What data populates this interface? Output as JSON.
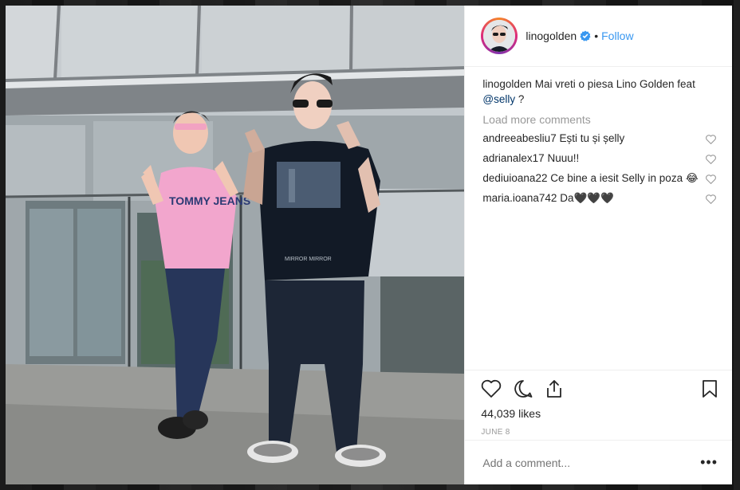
{
  "post": {
    "username": "linogolden",
    "follow_label": "Follow",
    "separator": "•",
    "caption_user": "linogolden",
    "caption_text": "Mai vreti o piesa Lino Golden feat",
    "caption_mention": "@selly",
    "caption_end": "?",
    "load_more_label": "Load more comments",
    "likes": "44,039 likes",
    "date": "JUNE 8",
    "add_comment_placeholder": "Add a comment...",
    "more_label": "•••"
  },
  "comments": [
    {
      "user": "andreeabesliu7",
      "text": "Ești tu și șelly"
    },
    {
      "user": "adrianalex17",
      "text": "Nuuu!!"
    },
    {
      "user": "dediuioana22",
      "text": "Ce bine a iesit Selly in poza 😂"
    },
    {
      "user": "maria.ioana742",
      "text": "Da🖤🖤🖤"
    }
  ],
  "icons": {
    "verified": "verified-badge-icon",
    "like": "heart-icon",
    "comment": "comment-bubble-icon",
    "share": "share-icon",
    "save": "bookmark-icon",
    "comment_like": "heart-outline-icon"
  },
  "colors": {
    "link": "#3897f0",
    "text": "#262626",
    "muted": "#999999",
    "mention": "#003569"
  }
}
